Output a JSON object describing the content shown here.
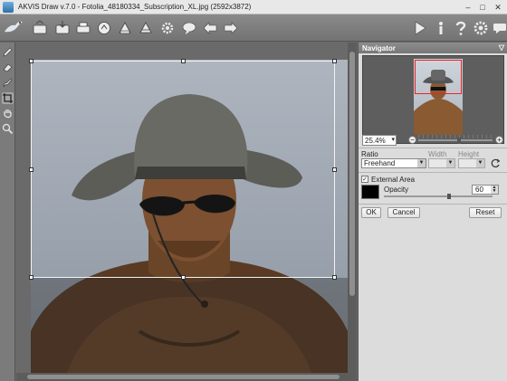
{
  "window": {
    "title": "AKVIS Draw v.7.0 - Fotolia_48180334_Subscription_XL.jpg (2592x3872)",
    "minimize": "–",
    "maximize": "□",
    "close": "✕"
  },
  "toolbar": {
    "left_buttons": [
      "open-icon",
      "save-icon",
      "print-icon",
      "share-icon",
      "batch-icon",
      "import-icon",
      "settings-gear-icon",
      "presets-icon",
      "undo-arrow-icon",
      "redo-arrow-icon"
    ],
    "right_buttons": [
      "run-icon",
      "info-icon",
      "help-icon",
      "preferences-icon",
      "comment-icon"
    ]
  },
  "tools": [
    "pencil-icon",
    "eraser-icon",
    "brush-icon",
    "crop-icon",
    "hand-icon",
    "zoom-icon"
  ],
  "navigator": {
    "title": "Navigator",
    "zoom_value": "25.4%",
    "zoom_level": 0.55
  },
  "crop": {
    "ratio_label": "Ratio",
    "ratio_value": "Freehand",
    "width_label": "Width",
    "height_label": "Height",
    "external_area_label": "External Area",
    "external_area_checked": true,
    "opacity_label": "Opacity",
    "opacity_value": "60",
    "opacity_level": 0.6,
    "swatch_color": "#000000",
    "ok_label": "OK",
    "cancel_label": "Cancel",
    "reset_label": "Reset"
  },
  "colors": {
    "toolbar_bg": "#7f7f7f",
    "panel_bg": "#dcdcdc",
    "crop_frame": "#f3f3f3"
  }
}
